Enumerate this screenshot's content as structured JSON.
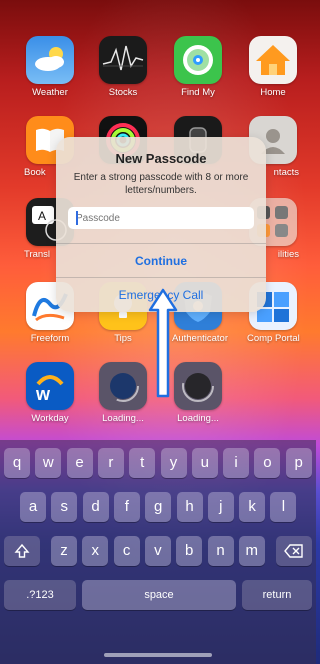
{
  "apps": [
    {
      "id": "weather",
      "label": "Weather",
      "icon": "weather-icon"
    },
    {
      "id": "stocks",
      "label": "Stocks",
      "icon": "stocks-icon"
    },
    {
      "id": "findmy",
      "label": "Find My",
      "icon": "find-my-icon"
    },
    {
      "id": "home",
      "label": "Home",
      "icon": "home-icon"
    },
    {
      "id": "books",
      "label": "Book",
      "icon": "books-icon"
    },
    {
      "id": "fitness",
      "label": "",
      "icon": "fitness-icon"
    },
    {
      "id": "watch",
      "label": "",
      "icon": "watch-icon"
    },
    {
      "id": "contacts",
      "label": "ntacts",
      "icon": "contacts-icon"
    },
    {
      "id": "translate",
      "label": "Transl",
      "icon": "translate-icon"
    },
    {
      "id": "utilities",
      "label": "ilities",
      "icon": "utilities-folder-icon"
    },
    {
      "id": "freeform",
      "label": "Freeform",
      "icon": "freeform-icon"
    },
    {
      "id": "tips",
      "label": "Tips",
      "icon": "tips-icon"
    },
    {
      "id": "authenticator",
      "label": "Authenticator",
      "icon": "authenticator-icon"
    },
    {
      "id": "compportal",
      "label": "Comp Portal",
      "icon": "comp-portal-icon"
    },
    {
      "id": "workday",
      "label": "Workday",
      "icon": "workday-icon"
    },
    {
      "id": "loading1",
      "label": "Loading...",
      "icon": "loading-app-icon"
    },
    {
      "id": "loading2",
      "label": "Loading...",
      "icon": "loading-app-icon"
    }
  ],
  "dialog": {
    "title": "New Passcode",
    "message": "Enter a strong passcode with 8 or more letters/numbers.",
    "placeholder": "Passcode",
    "continue_label": "Continue",
    "emergency_label": "Emergency Call"
  },
  "keyboard": {
    "row1": [
      "q",
      "w",
      "e",
      "r",
      "t",
      "y",
      "u",
      "i",
      "o",
      "p"
    ],
    "row2": [
      "a",
      "s",
      "d",
      "f",
      "g",
      "h",
      "j",
      "k",
      "l"
    ],
    "row3": [
      "z",
      "x",
      "c",
      "v",
      "b",
      "n",
      "m"
    ],
    "shift_icon": "shift-icon",
    "delete_icon": "delete-icon",
    "numbers_label": ".?123",
    "space_label": "space",
    "return_label": "return"
  },
  "colors": {
    "accent": "#1f6fe0",
    "arrow": "#1f6fe0"
  }
}
